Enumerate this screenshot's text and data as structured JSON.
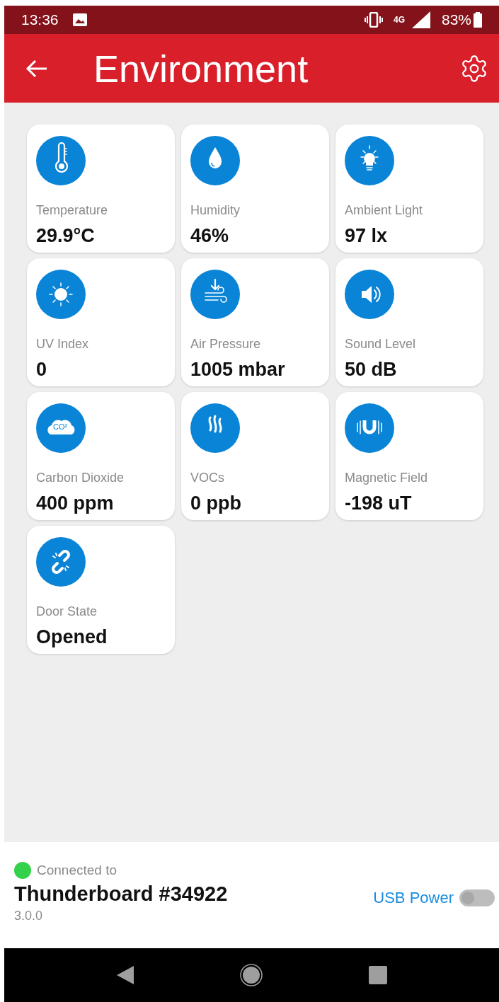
{
  "status_bar": {
    "time": "13:36",
    "network": "4G",
    "battery": "83%"
  },
  "header": {
    "title": "Environment"
  },
  "sensors": [
    {
      "kind": "thermometer",
      "label": "Temperature",
      "value": "29.9°C"
    },
    {
      "kind": "drop",
      "label": "Humidity",
      "value": "46%"
    },
    {
      "kind": "bulb",
      "label": "Ambient Light",
      "value": "97 lx"
    },
    {
      "kind": "sun",
      "label": "UV Index",
      "value": "0"
    },
    {
      "kind": "pressure",
      "label": "Air Pressure",
      "value": "1005 mbar"
    },
    {
      "kind": "speaker",
      "label": "Sound Level",
      "value": "50 dB"
    },
    {
      "kind": "cloud",
      "icon_text": "CO²",
      "label": "Carbon Dioxide",
      "value": "400 ppm"
    },
    {
      "kind": "steam",
      "label": "VOCs",
      "value": "0 ppb"
    },
    {
      "kind": "magnet",
      "label": "Magnetic Field",
      "value": "-198 uT"
    },
    {
      "kind": "link",
      "label": "Door State",
      "value": "Opened"
    }
  ],
  "connection": {
    "connected": true,
    "caption": "Connected to",
    "device": "Thunderboard #34922",
    "version": "3.0.0",
    "power_label": "USB Power",
    "power_on": false
  }
}
